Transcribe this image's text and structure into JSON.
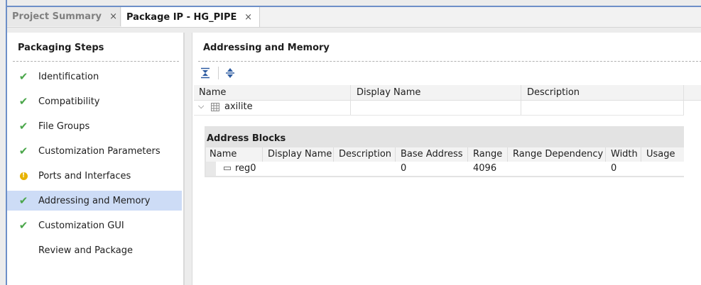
{
  "tabs": [
    {
      "label": "Project Summary",
      "close": "×"
    },
    {
      "label": "Package IP - HG_PIPE",
      "close": "×"
    }
  ],
  "steps_panel": {
    "title": "Packaging Steps",
    "steps": [
      {
        "label": "Identification",
        "status": "check-icon"
      },
      {
        "label": "Compatibility",
        "status": "check-icon"
      },
      {
        "label": "File Groups",
        "status": "check-icon"
      },
      {
        "label": "Customization Parameters",
        "status": "check-icon"
      },
      {
        "label": "Ports and Interfaces",
        "status": "warning-icon"
      },
      {
        "label": "Addressing and Memory",
        "status": "check-icon",
        "selected": true
      },
      {
        "label": "Customization GUI",
        "status": "check-icon"
      },
      {
        "label": "Review and Package",
        "status": "none"
      }
    ]
  },
  "main": {
    "title": "Addressing and Memory",
    "toolbar": {
      "collapse_icon": "collapse-all-icon",
      "expand_icon": "expand-all-icon"
    },
    "memory_map_table": {
      "columns": [
        "Name",
        "Display Name",
        "Description"
      ],
      "rows": [
        {
          "name": "axilite",
          "display_name": "",
          "description": ""
        }
      ]
    },
    "address_blocks": {
      "title": "Address Blocks",
      "columns": [
        "Name",
        "Display Name",
        "Description",
        "Base Address",
        "Range",
        "Range Dependency",
        "Width",
        "Usage"
      ],
      "rows": [
        {
          "name": "reg0",
          "display_name": "",
          "description": "",
          "base_address": "0",
          "range": "4096",
          "range_dependency": "",
          "width": "0",
          "usage": ""
        }
      ]
    }
  },
  "colors": {
    "accent": "#6d8fc8",
    "selected": "#cddcf6",
    "check": "#4aa64a",
    "warning": "#e8b300"
  }
}
